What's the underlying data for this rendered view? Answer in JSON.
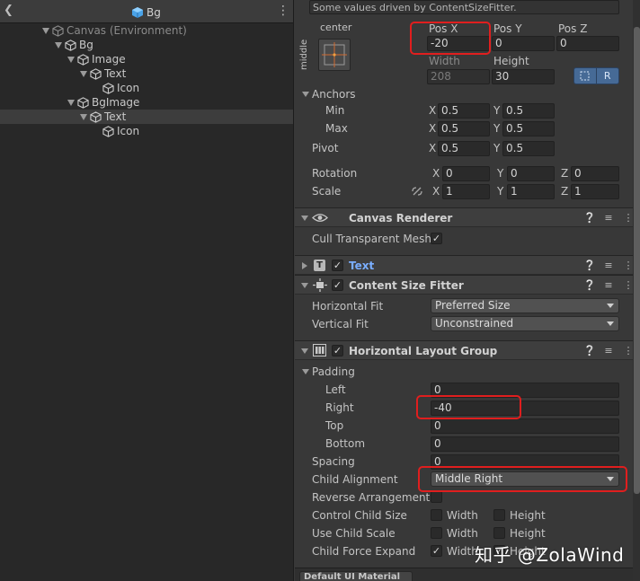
{
  "hierarchy": {
    "title": "Bg",
    "rows": [
      {
        "label": "Canvas (Environment)"
      },
      {
        "label": "Bg"
      },
      {
        "label": "Image"
      },
      {
        "label": "Text"
      },
      {
        "label": "Icon"
      },
      {
        "label": "BgImage"
      },
      {
        "label": "Text"
      },
      {
        "label": "Icon"
      }
    ]
  },
  "inspector": {
    "driven_note": "Some values driven by ContentSizeFitter.",
    "anchor_preset": {
      "horizontal": "center",
      "vertical": "middle"
    },
    "rect": {
      "posx_label": "Pos X",
      "posx": "-20",
      "posy_label": "Pos Y",
      "posy": "0",
      "posz_label": "Pos Z",
      "posz": "0",
      "width_label": "Width",
      "width": "208",
      "height_label": "Height",
      "height": "30",
      "r_button": "R"
    },
    "anchors": {
      "label": "Anchors",
      "min_label": "Min",
      "min_x": "0.5",
      "min_y": "0.5",
      "max_label": "Max",
      "max_x": "0.5",
      "max_y": "0.5"
    },
    "pivot": {
      "label": "Pivot",
      "x": "0.5",
      "y": "0.5"
    },
    "rotation": {
      "label": "Rotation",
      "x": "0",
      "y": "0",
      "z": "0"
    },
    "scale": {
      "label": "Scale",
      "x": "1",
      "y": "1",
      "z": "1"
    },
    "axis": {
      "x": "X",
      "y": "Y",
      "z": "Z"
    },
    "canvas_renderer": {
      "title": "Canvas Renderer",
      "cull_label": "Cull Transparent Mesh"
    },
    "text_component": {
      "title": "Text"
    },
    "content_size_fitter": {
      "title": "Content Size Fitter",
      "hfit_label": "Horizontal Fit",
      "hfit_value": "Preferred Size",
      "vfit_label": "Vertical Fit",
      "vfit_value": "Unconstrained"
    },
    "hlayout": {
      "title": "Horizontal Layout Group",
      "padding_label": "Padding",
      "left_label": "Left",
      "left": "0",
      "right_label": "Right",
      "right": "-40",
      "top_label": "Top",
      "top": "0",
      "bottom_label": "Bottom",
      "bottom": "0",
      "spacing_label": "Spacing",
      "spacing": "0",
      "alignment_label": "Child Alignment",
      "alignment_value": "Middle Right",
      "reverse_label": "Reverse Arrangement",
      "control_label": "Control Child Size",
      "use_scale_label": "Use Child Scale",
      "force_label": "Child Force Expand",
      "width_opt": "Width",
      "height_opt": "Height"
    },
    "material_label": "Default UI Material"
  },
  "watermark": "知乎 @ZolaWind",
  "colors": {
    "highlight": "#e01e1e",
    "text_link": "#7aaeff"
  }
}
